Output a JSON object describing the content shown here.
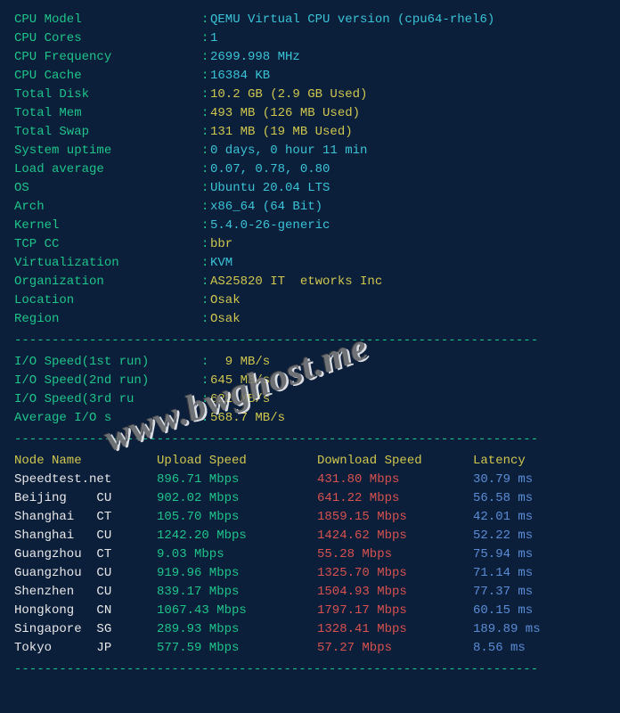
{
  "sysinfo": [
    {
      "label": "CPU Model            ",
      "value": "QEMU Virtual CPU version (cpu64-rhel6)",
      "color": "cyan"
    },
    {
      "label": "CPU Cores            ",
      "value": "1",
      "color": "cyan"
    },
    {
      "label": "CPU Frequency        ",
      "value": "2699.998 MHz",
      "color": "cyan"
    },
    {
      "label": "CPU Cache            ",
      "value": "16384 KB",
      "color": "cyan"
    },
    {
      "label": "Total Disk           ",
      "value": "10.2 GB (2.9 GB Used)",
      "color": "yellow"
    },
    {
      "label": "Total Mem            ",
      "value": "493 MB (126 MB Used)",
      "color": "yellow"
    },
    {
      "label": "Total Swap           ",
      "value": "131 MB (19 MB Used)",
      "color": "yellow"
    },
    {
      "label": "System uptime        ",
      "value": "0 days, 0 hour 11 min",
      "color": "cyan"
    },
    {
      "label": "Load average         ",
      "value": "0.07, 0.78, 0.80",
      "color": "cyan"
    },
    {
      "label": "OS                   ",
      "value": "Ubuntu 20.04 LTS",
      "color": "cyan"
    },
    {
      "label": "Arch                 ",
      "value": "x86_64 (64 Bit)",
      "color": "cyan"
    },
    {
      "label": "Kernel               ",
      "value": "5.4.0-26-generic",
      "color": "cyan"
    },
    {
      "label": "TCP CC               ",
      "value": "bbr",
      "color": "yellow"
    },
    {
      "label": "Virtualization       ",
      "value": "KVM",
      "color": "cyan"
    },
    {
      "label": "Organization         ",
      "value": "AS25820 IT  etworks Inc",
      "color": "yellow"
    },
    {
      "label": "Location             ",
      "value": "Osak",
      "color": "yellow"
    },
    {
      "label": "Region               ",
      "value": "Osak",
      "color": "yellow"
    }
  ],
  "io": [
    {
      "label": "I/O Speed(1st run)   ",
      "value": "  9 MB/s",
      "color": "yellow"
    },
    {
      "label": "I/O Speed(2nd run)   ",
      "value": "645 MB/s",
      "color": "yellow"
    },
    {
      "label": "I/O Speed(3rd ru     ",
      "value": "622 MB/s",
      "color": "yellow"
    },
    {
      "label": "Average I/O s        ",
      "value": "568.7 MB/s",
      "color": "yellow"
    }
  ],
  "speed_header": {
    "node": "Node Name",
    "upload": "Upload Speed",
    "download": "Download Speed",
    "latency": "Latency"
  },
  "speed": [
    {
      "node": "Speedtest.net   ",
      "upload": "896.71 Mbps     ",
      "download": "431.80 Mbps     ",
      "latency": "30.79 ms"
    },
    {
      "node": "Beijing    CU   ",
      "upload": "902.02 Mbps     ",
      "download": "641.22 Mbps     ",
      "latency": "56.58 ms"
    },
    {
      "node": "Shanghai   CT   ",
      "upload": "105.70 Mbps     ",
      "download": "1859.15 Mbps    ",
      "latency": "42.01 ms"
    },
    {
      "node": "Shanghai   CU   ",
      "upload": "1242.20 Mbps    ",
      "download": "1424.62 Mbps    ",
      "latency": "52.22 ms"
    },
    {
      "node": "Guangzhou  CT   ",
      "upload": "9.03 Mbps       ",
      "download": "55.28 Mbps      ",
      "latency": "75.94 ms"
    },
    {
      "node": "Guangzhou  CU   ",
      "upload": "919.96 Mbps     ",
      "download": "1325.70 Mbps    ",
      "latency": "71.14 ms"
    },
    {
      "node": "Shenzhen   CU   ",
      "upload": "839.17 Mbps     ",
      "download": "1504.93 Mbps    ",
      "latency": "77.37 ms"
    },
    {
      "node": "Hongkong   CN   ",
      "upload": "1067.43 Mbps    ",
      "download": "1797.17 Mbps    ",
      "latency": "60.15 ms"
    },
    {
      "node": "Singapore  SG   ",
      "upload": "289.93 Mbps     ",
      "download": "1328.41 Mbps    ",
      "latency": "189.89 ms"
    },
    {
      "node": "Tokyo      JP   ",
      "upload": "577.59 Mbps     ",
      "download": "57.27 Mbps      ",
      "latency": "8.56 ms"
    }
  ],
  "divider_line": "----------------------------------------------------------------------",
  "watermark": "www.bwghost.me"
}
